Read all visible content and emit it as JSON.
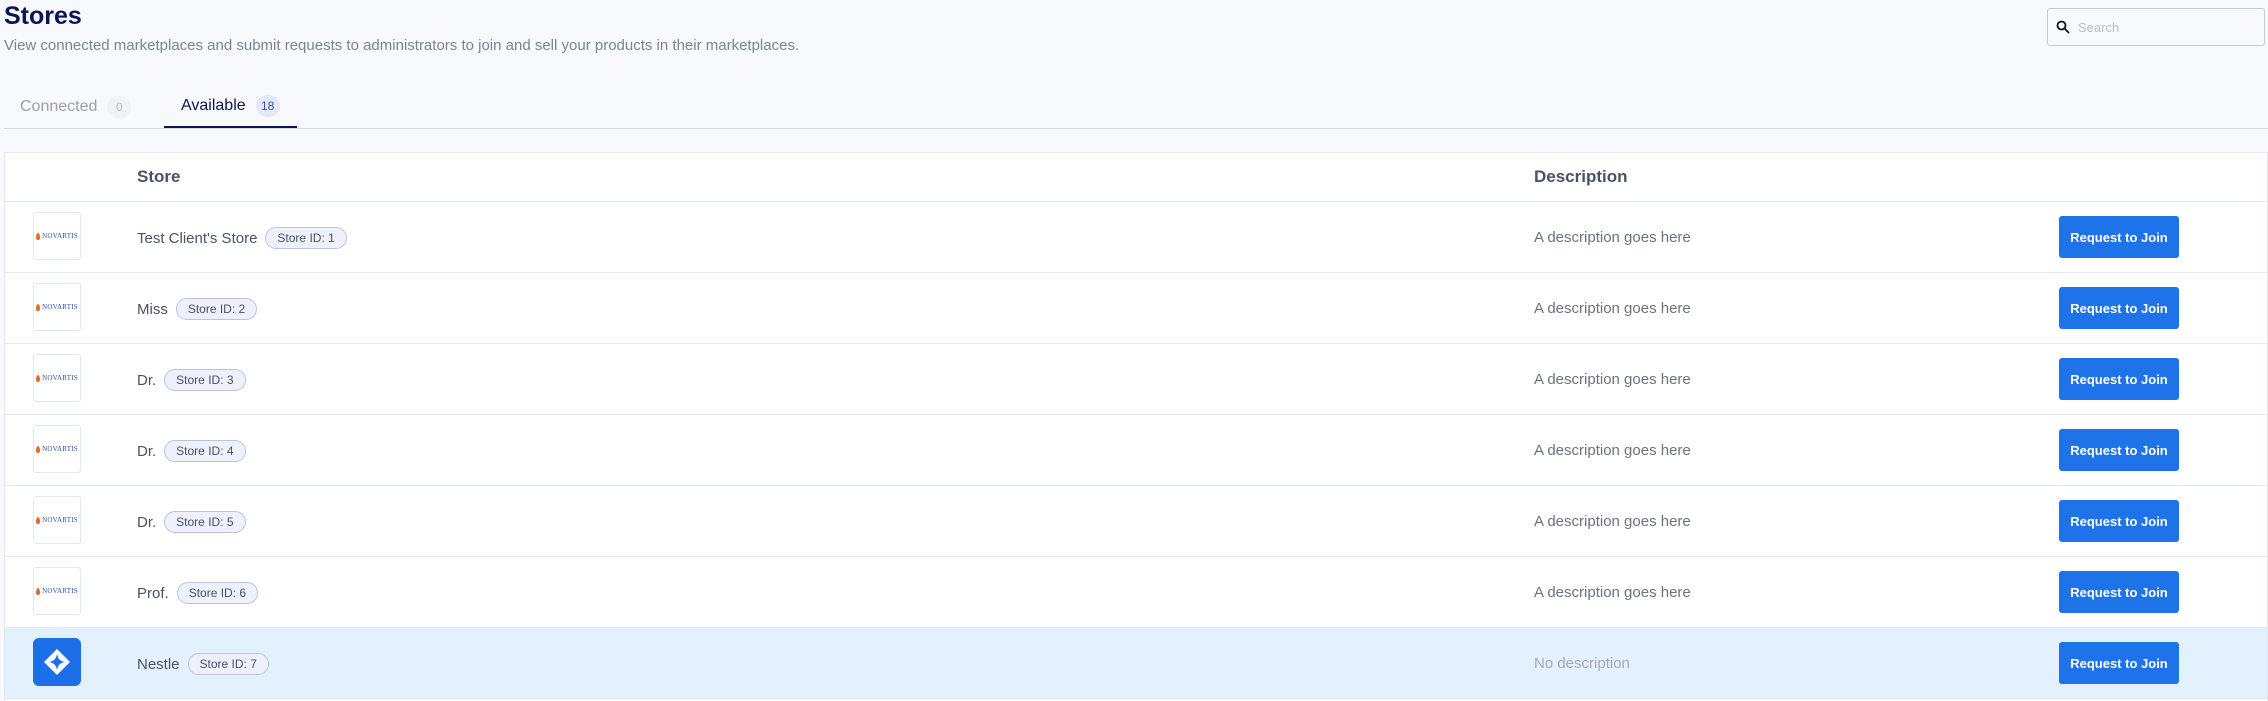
{
  "header": {
    "title": "Stores",
    "subtitle": "View connected marketplaces and submit requests to administrators to join and sell your products in their marketplaces."
  },
  "search": {
    "placeholder": "Search",
    "value": "",
    "icon": "search-icon"
  },
  "tabs": [
    {
      "label": "Connected",
      "count": "0",
      "active": false
    },
    {
      "label": "Available",
      "count": "18",
      "active": true
    }
  ],
  "table": {
    "columns": {
      "store": "Store",
      "description": "Description"
    },
    "join_label": "Request to Join",
    "logo_text": "NOVARTIS",
    "rows": [
      {
        "name": "Test Client's Store",
        "badge": "Store ID: 1",
        "description": "A description goes here",
        "logo": "novartis-logo"
      },
      {
        "name": "Miss",
        "badge": "Store ID: 2",
        "description": "A description goes here",
        "logo": "novartis-logo"
      },
      {
        "name": "Dr.",
        "badge": "Store ID: 3",
        "description": "A description goes here",
        "logo": "novartis-logo"
      },
      {
        "name": "Dr.",
        "badge": "Store ID: 4",
        "description": "A description goes here",
        "logo": "novartis-logo"
      },
      {
        "name": "Dr.",
        "badge": "Store ID: 5",
        "description": "A description goes here",
        "logo": "novartis-logo"
      },
      {
        "name": "Prof.",
        "badge": "Store ID: 6",
        "description": "A description goes here",
        "logo": "novartis-logo"
      },
      {
        "name": "Nestle",
        "badge": "Store ID: 7",
        "description": "No description",
        "logo": "brand-logo"
      }
    ]
  },
  "colors": {
    "accent": "#1f73e8",
    "title": "#0d1456",
    "highlight_row": "#e2f1fd"
  }
}
